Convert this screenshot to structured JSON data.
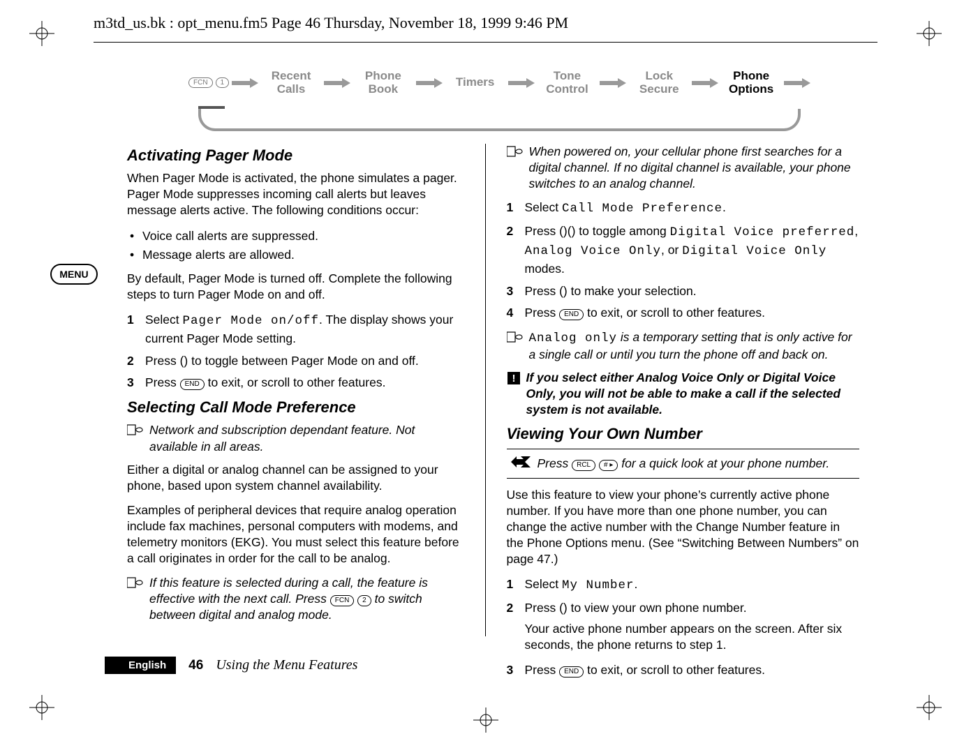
{
  "header": {
    "text": "m3td_us.bk : opt_menu.fm5  Page 46  Thursday, November 18, 1999  9:46 PM"
  },
  "menu_tab": {
    "label": "MENU"
  },
  "breadcrumb": {
    "prefix_keys": [
      "FCN",
      "1"
    ],
    "items": [
      {
        "label_top": "Recent",
        "label_bot": "Calls",
        "active": false
      },
      {
        "label_top": "Phone",
        "label_bot": "Book",
        "active": false
      },
      {
        "label_top": "Timers",
        "label_bot": "",
        "active": false
      },
      {
        "label_top": "Tone",
        "label_bot": "Control",
        "active": false
      },
      {
        "label_top": "Lock",
        "label_bot": "Secure",
        "active": false
      },
      {
        "label_top": "Phone",
        "label_bot": "Options",
        "active": true
      }
    ]
  },
  "left": {
    "h_pager": "Activating Pager Mode",
    "pager_intro": "When Pager Mode is activated, the phone simulates a pager. Pager Mode suppresses incoming call alerts but leaves message alerts active. The following conditions occur:",
    "pager_bullets": [
      "Voice call alerts are suppressed.",
      "Message alerts are allowed."
    ],
    "pager_default": "By default, Pager Mode is turned off. Complete the following steps to turn Pager Mode on and off.",
    "steps_pager": [
      {
        "pre": "Select ",
        "lcd": "Pager Mode on/off",
        "post": ". The display shows your current Pager Mode setting."
      },
      {
        "pre": "Press ",
        "key": "()",
        "post": " to toggle between Pager Mode on and off."
      },
      {
        "pre": "Press ",
        "pill": "END",
        "post": " to exit, or scroll to other features."
      }
    ],
    "h_callmode": "Selecting Call Mode Preference",
    "callmode_note": "Network and subscription dependant feature. Not available in all areas.",
    "callmode_p1": "Either a digital or analog channel can be assigned to your phone, based upon system channel availability.",
    "callmode_p2": "Examples of peripheral devices that require analog operation include fax machines, personal computers with modems, and telemetry monitors (EKG). You must select this feature before a call originates in order for the call to be analog.",
    "callmode_note2_a": "If this feature is selected during a call, the feature is effective with the next call. Press ",
    "callmode_note2_pill1": "FCN",
    "callmode_note2_pill2": "2",
    "callmode_note2_b": " to switch between digital and analog mode."
  },
  "right": {
    "powernote": "When powered on, your cellular phone first searches for a digital channel. If no digital channel is available, your phone switches to an analog channel.",
    "steps_callmode": {
      "s1_pre": "Select ",
      "s1_lcd": "Call Mode Preference",
      "s1_post": ".",
      "s2_pre": "Press ",
      "s2_sidekeys": "()()",
      "s2_mid": " to toggle among ",
      "s2_lcd1": "Digital Voice preferred",
      "s2_lcd2": "Analog Voice Only",
      "s2_lcd3": "Digital Voice Only",
      "s2_or": ", or ",
      "s2_comma": ", ",
      "s2_end": " modes.",
      "s3_pre": "Press ",
      "s3_key": "()",
      "s3_post": " to make your selection.",
      "s4_pre": "Press ",
      "s4_pill": "END",
      "s4_post": " to exit, or scroll to other features."
    },
    "analog_note_lcd": "Analog only",
    "analog_note_txt": " is a temporary setting that is only active for a single call or until you turn the phone off and back on.",
    "warn": "If you select either Analog Voice Only or Digital Voice Only, you will not be able to make a call if the selected system is not available.",
    "h_own": "Viewing Your Own Number",
    "shortcut_pre": "Press ",
    "shortcut_pill1": "RCL",
    "shortcut_pill2": "# ▸",
    "shortcut_post": " for a quick look at your phone number.",
    "own_p": "Use this feature to view your phone’s currently active phone number. If you have more than one phone number, you can change the active number with the Change Number feature in the Phone Options menu. (See “Switching Between Numbers” on page 47.)",
    "steps_own": {
      "s1_pre": "Select ",
      "s1_lcd": "My Number",
      "s1_post": ".",
      "s2_pre": "Press ",
      "s2_key": "()",
      "s2_post": " to view your own phone number.",
      "s2_extra": "Your active phone number appears on the screen. After six seconds, the phone returns to step 1.",
      "s3_pre": "Press ",
      "s3_pill": "END",
      "s3_post": " to exit, or scroll to other features."
    }
  },
  "footer": {
    "lang": "English",
    "page": "46",
    "title": "Using the Menu Features"
  }
}
